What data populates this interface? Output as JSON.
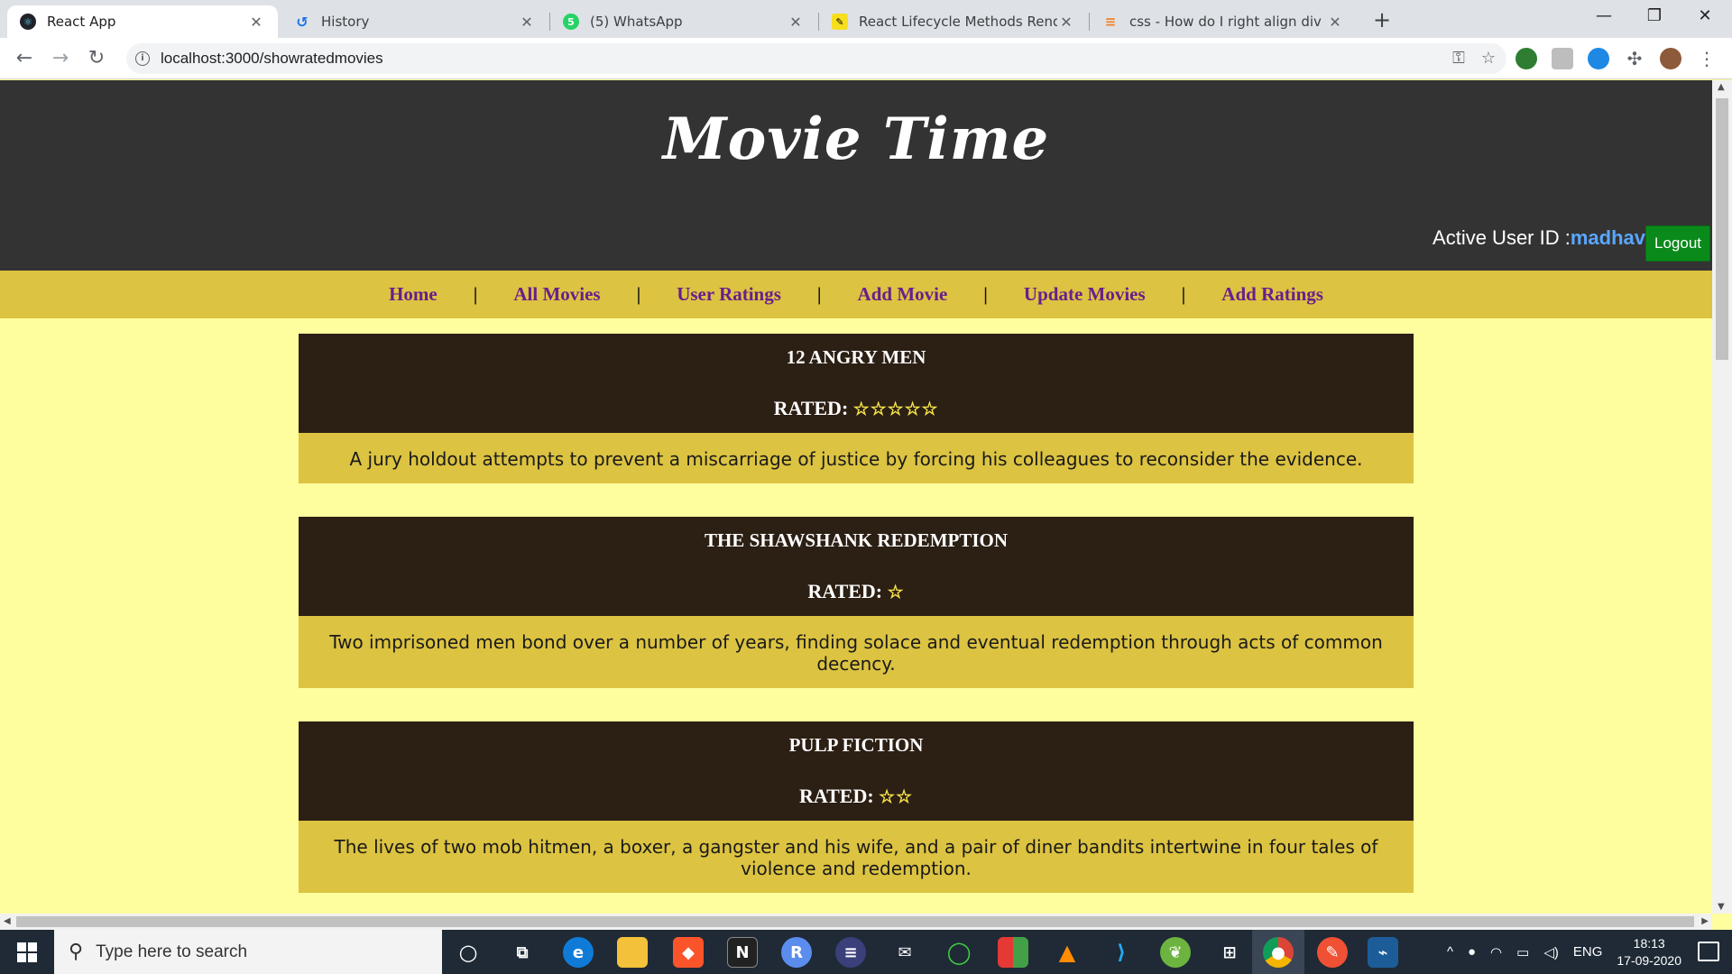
{
  "browser": {
    "tabs": [
      {
        "title": "React App",
        "icon": "react-icon"
      },
      {
        "title": "History",
        "icon": "history-icon"
      },
      {
        "title": "(5) WhatsApp",
        "icon": "whatsapp-icon",
        "badge": "5"
      },
      {
        "title": "React Lifecycle Methods Render /",
        "icon": "edit-pencil-icon"
      },
      {
        "title": "css - How do I right align div eler",
        "icon": "stackoverflow-icon"
      }
    ],
    "url": "localhost:3000/showratedmovies"
  },
  "site": {
    "title": "Movie Time",
    "active_user_label": "Active User ID :",
    "active_user_id": "madhav",
    "logout_label": "Logout"
  },
  "nav": {
    "items": [
      "Home",
      "All Movies",
      "User Ratings",
      "Add Movie",
      "Update Movies",
      "Add Ratings"
    ],
    "separator": "|"
  },
  "movies": [
    {
      "title": "12 ANGRY MEN",
      "rated_label": "RATED:",
      "stars": "☆☆☆☆☆",
      "rating": 5,
      "description": "A jury holdout attempts to prevent a miscarriage of justice by forcing his colleagues to reconsider the evidence."
    },
    {
      "title": "THE SHAWSHANK REDEMPTION",
      "rated_label": "RATED:",
      "stars": "☆",
      "rating": 1,
      "description": "Two imprisoned men bond over a number of years, finding solace and eventual redemption through acts of common decency."
    },
    {
      "title": "PULP FICTION",
      "rated_label": "RATED:",
      "stars": "☆☆",
      "rating": 2,
      "description": "The lives of two mob hitmen, a boxer, a gangster and his wife, and a pair of diner bandits intertwine in four tales of violence and redemption."
    }
  ],
  "taskbar": {
    "search_placeholder": "Type here to search",
    "language": "ENG",
    "time": "18:13",
    "date": "17-09-2020"
  },
  "colors": {
    "header_bg": "#333333",
    "nav_bg": "#dcc341",
    "page_bg": "#fffe9e",
    "card_head_bg": "#2c1f14",
    "nav_link": "#6a1e8c",
    "logout_bg": "#0a8a1a"
  }
}
